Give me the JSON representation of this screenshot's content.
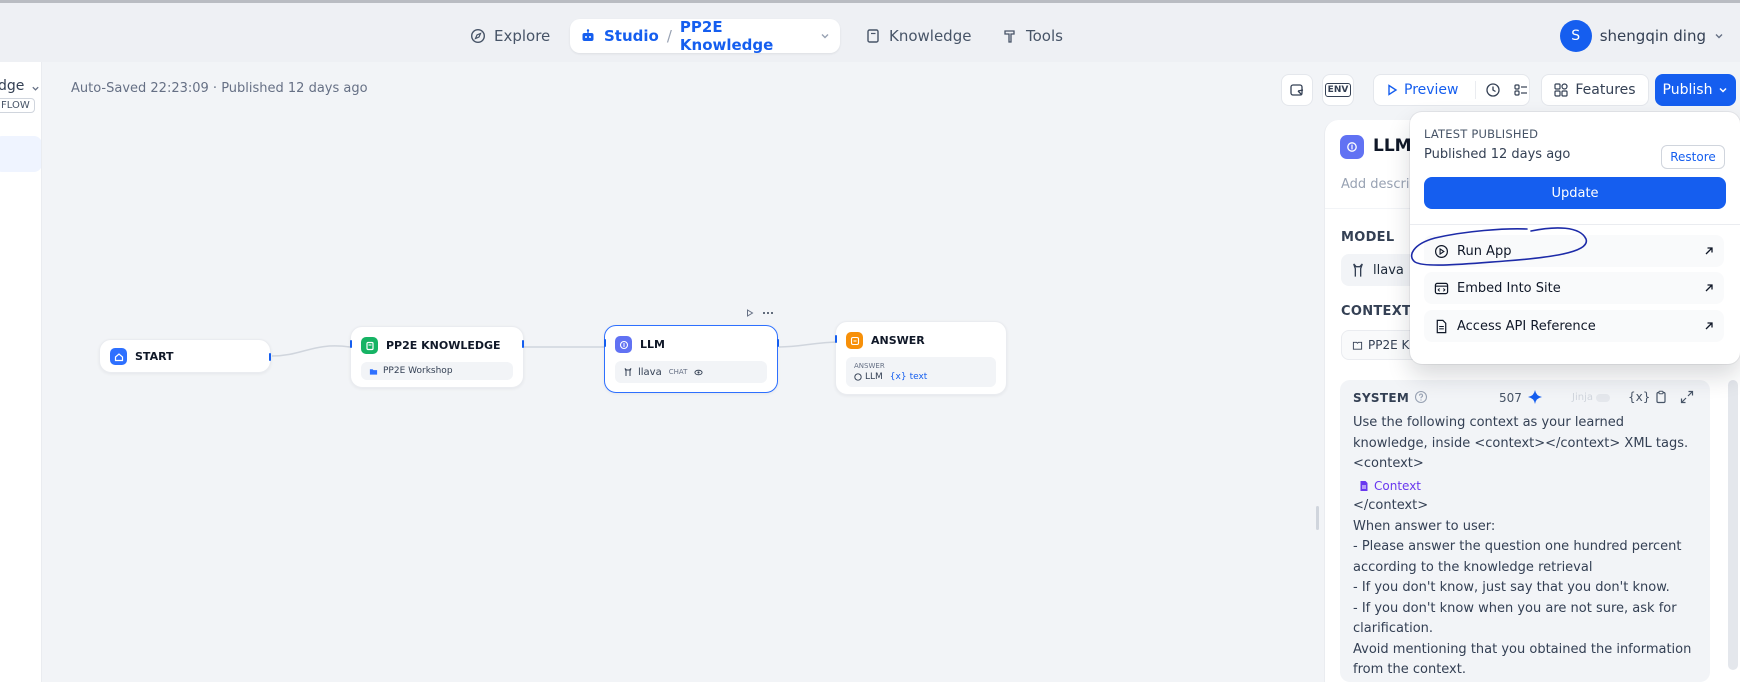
{
  "nav": {
    "explore": "Explore",
    "studio": "Studio",
    "separator": "/",
    "app_name": "PP2E Knowledge",
    "knowledge": "Knowledge",
    "tools": "Tools"
  },
  "user": {
    "initial": "S",
    "name": "shengqin ding"
  },
  "sidebar": {
    "title_fragment": "dge",
    "tag_fragment": "FLOW"
  },
  "status": {
    "autosave": "Auto-Saved 22:23:09 · Published 12 days ago"
  },
  "toolbar": {
    "env_label": "ENV",
    "preview": "Preview",
    "features": "Features",
    "publish": "Publish"
  },
  "nodes": {
    "start": {
      "title": "START"
    },
    "knowledge": {
      "title": "PP2E KNOWLEDGE",
      "dataset": "PP2E Workshop"
    },
    "llm": {
      "title": "LLM",
      "model": "llava",
      "mode": "CHAT"
    },
    "answer": {
      "title": "ANSWER",
      "field_label": "ANSWER",
      "var_node": "LLM",
      "var_prefix": "{x}",
      "var_name": "text"
    }
  },
  "panel": {
    "title": "LLM",
    "description_placeholder": "Add descrip",
    "model_label": "MODEL",
    "model_value": "llava",
    "context_label": "CONTEXT",
    "context_value": "PP2E K",
    "system_label": "SYSTEM",
    "token_count": "507",
    "jinja_label": "Jinja",
    "var_icon": "{x}",
    "prompt_lines": [
      "Use the following context as your learned",
      "knowledge, inside <context></context> XML tags.",
      "<context>",
      "</context>",
      "When answer to user:",
      "- Please answer the question one hundred percent",
      "according to the knowledge retrieval",
      "- If you don't know, just say that you don't know.",
      "- If you don't know when you are not sure, ask for",
      "clarification.",
      "Avoid mentioning that you obtained the information",
      "from the context."
    ],
    "context_chip": "Context"
  },
  "publish_menu": {
    "header": "LATEST PUBLISHED",
    "published": "Published 12 days ago",
    "restore": "Restore",
    "update": "Update",
    "items": [
      "Run App",
      "Embed Into Site",
      "Access API Reference"
    ]
  },
  "colors": {
    "primary": "#155eef",
    "annotation": "#1d2ba8"
  }
}
